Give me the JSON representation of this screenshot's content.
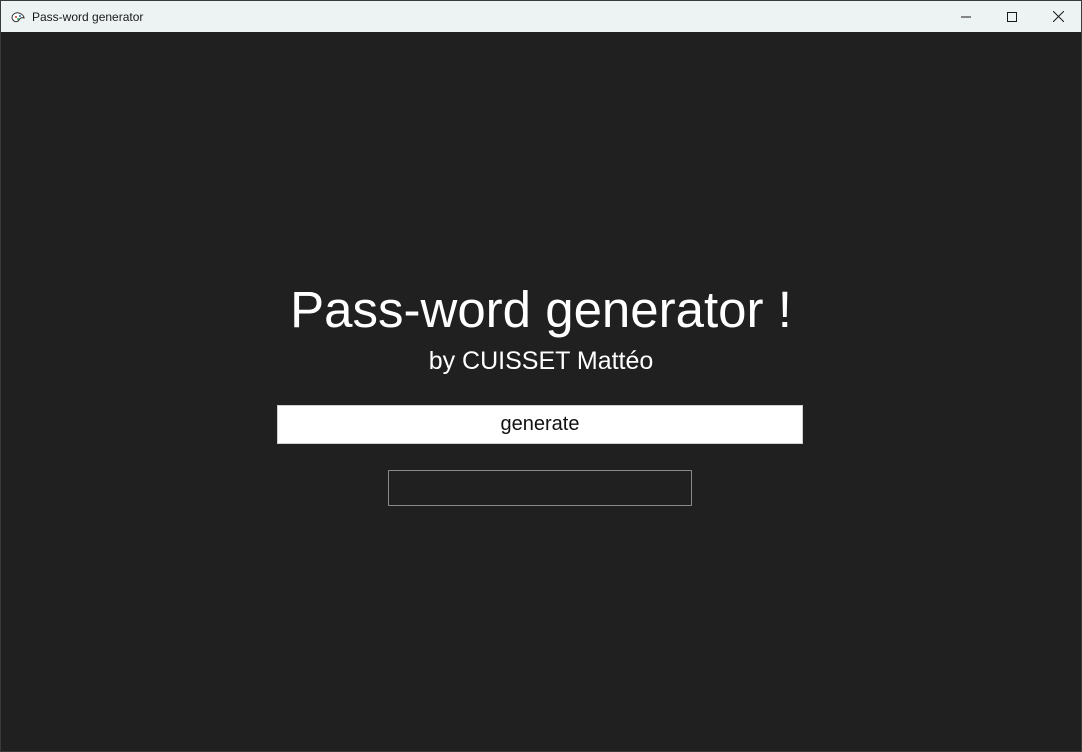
{
  "window": {
    "title": "Pass-word generator",
    "controls": {
      "minimize_icon": "minimize-icon",
      "maximize_icon": "maximize-icon",
      "close_icon": "close-icon"
    }
  },
  "main": {
    "heading": "Pass-word generator !",
    "subheading": "by CUISSET Mattéo",
    "generate_label": "generate",
    "output_value": ""
  },
  "colors": {
    "background": "#202020",
    "titlebar": "#edf2f3",
    "text": "#ffffff",
    "button_bg": "#ffffff"
  }
}
